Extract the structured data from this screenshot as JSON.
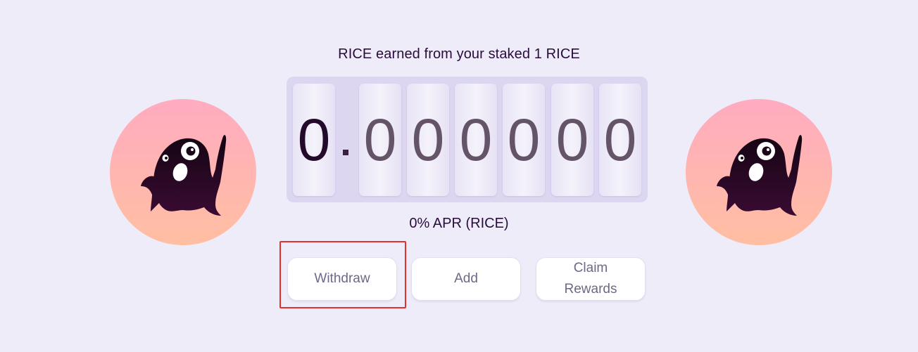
{
  "heading": "RICE earned from your staked 1 RICE",
  "counter": {
    "digits": [
      "0",
      "0",
      "0",
      "0",
      "0",
      "0",
      "0"
    ]
  },
  "apr": "0% APR (RICE)",
  "buttons": {
    "withdraw": "Withdraw",
    "add": "Add",
    "claim_line1": "Claim",
    "claim_line2": "Rewards"
  },
  "mascot": {
    "icon": "ghost-mascot-icon",
    "circle_top_color": "#ffabc0",
    "circle_bottom_color": "#ffbfa2",
    "body_color": "#1c0718"
  },
  "highlight_color": "#e0312c"
}
